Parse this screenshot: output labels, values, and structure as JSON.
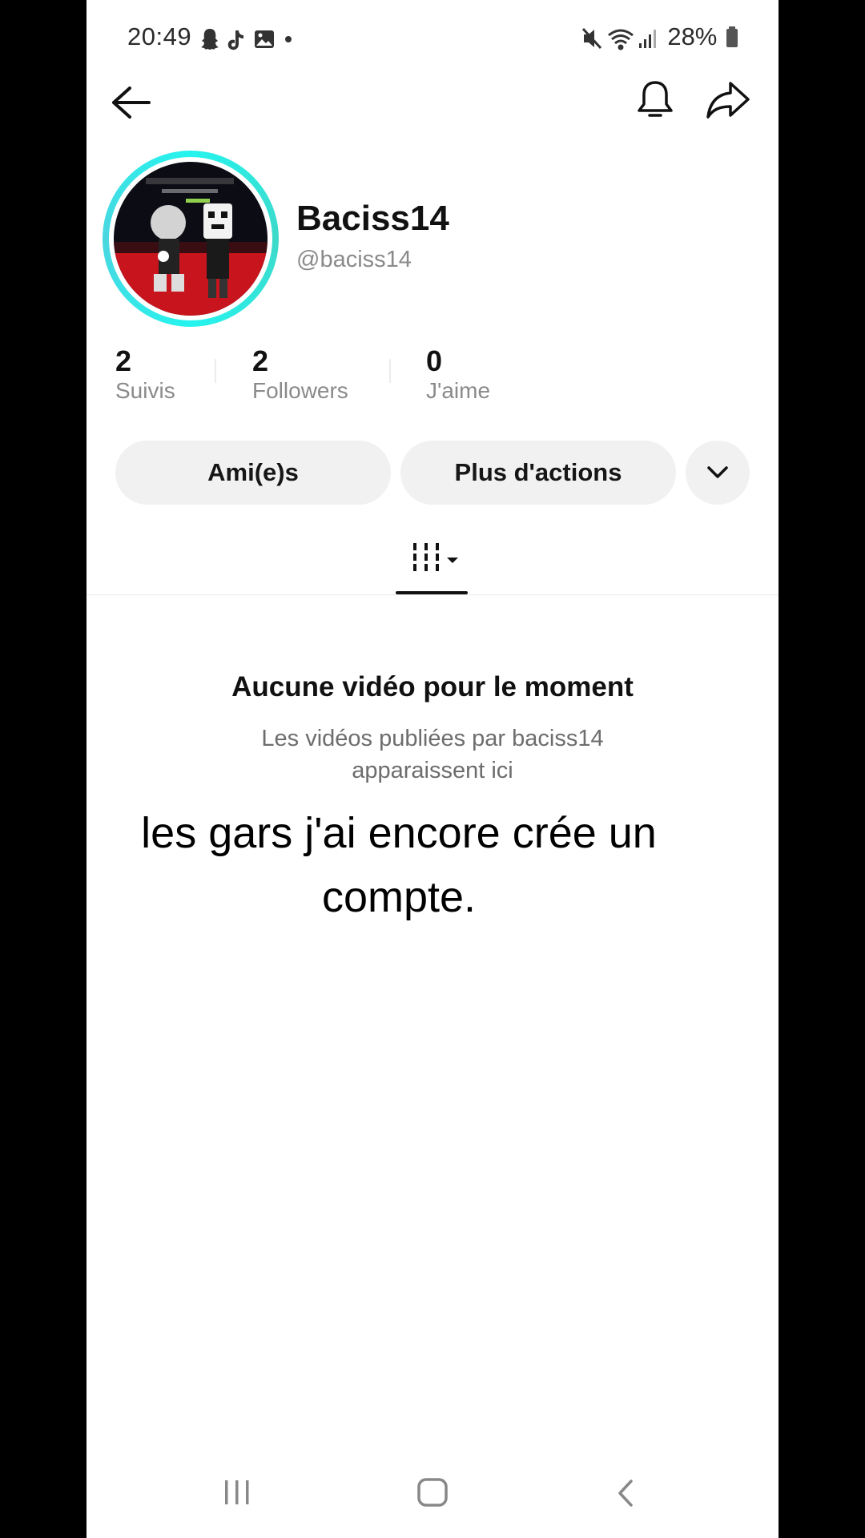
{
  "status_bar": {
    "time": "20:49",
    "battery": "28%",
    "icons": [
      "snapchat-icon",
      "tiktok-icon",
      "gallery-icon",
      "dot-icon",
      "mute-icon",
      "wifi-icon",
      "signal-icon",
      "battery-icon"
    ]
  },
  "header": {
    "icons": [
      "back-arrow-icon",
      "bell-icon",
      "share-icon"
    ]
  },
  "profile": {
    "display_name": "Baciss14",
    "username": "@baciss14",
    "avatar_ring_color": "#25f4ee"
  },
  "stats": [
    {
      "count": "2",
      "label": "Suivis"
    },
    {
      "count": "2",
      "label": "Followers"
    },
    {
      "count": "0",
      "label": "J'aime"
    }
  ],
  "actions": {
    "friends_label": "Ami(e)s",
    "more_actions_label": "Plus d'actions"
  },
  "tabs": {
    "active_icon": "grid-icon"
  },
  "empty_state": {
    "title": "Aucune vidéo pour le moment",
    "description": "Les vidéos publiées par baciss14 apparaissent ici"
  },
  "overlay_caption": "les gars j'ai encore crée un compte.",
  "nav_bar": {
    "icons": [
      "recents-icon",
      "home-icon",
      "back-icon"
    ]
  }
}
